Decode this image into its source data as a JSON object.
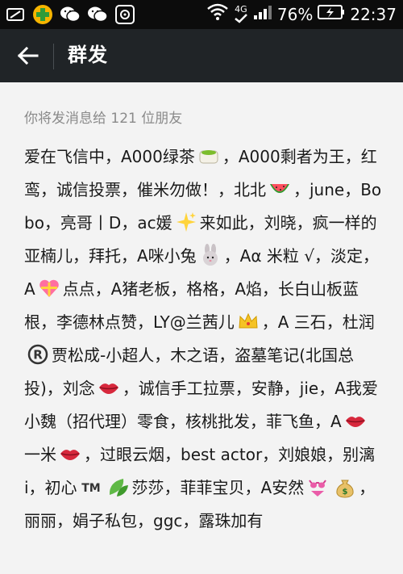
{
  "status_bar": {
    "left_icons": [
      "screen-icon",
      "game-icon",
      "wechat-icon",
      "wechat-icon",
      "shield-icon"
    ],
    "network": "4G",
    "battery": "76%",
    "time": "22:37"
  },
  "header": {
    "title": "群发"
  },
  "recipients": {
    "info": "你将发消息给 121 位朋友",
    "segments": [
      {
        "t": "爱在飞信中，A000绿茶"
      },
      {
        "e": "tea-icon"
      },
      {
        "t": "，A000剩者为王，红鸾，诚信投票，催米勿做！，北北"
      },
      {
        "e": "watermelon-icon"
      },
      {
        "t": "，june，Bobo，亮哥丨D，ac媛"
      },
      {
        "e": "sparkles-icon"
      },
      {
        "t": "来如此，刘晓，疯一样的亚楠儿，拜托，A咪小兔"
      },
      {
        "e": "rabbit-icon"
      },
      {
        "t": "，Aα 米粒 √，淡定，A"
      },
      {
        "e": "heart-gift-icon"
      },
      {
        "t": "点点，A猪老板，格格，A焰，长白山板蓝根，李德林点赞，LY@兰茜儿"
      },
      {
        "e": "crown-icon"
      },
      {
        "t": "，A 三石，杜润"
      },
      {
        "e": "registered-icon"
      },
      {
        "t": "贾松成-小超人，木之语，盗墓笔记(北国总投)，刘念"
      },
      {
        "e": "lips-icon"
      },
      {
        "t": "，诚信手工拉票，安静，jie，A我爱小魏（招代理）零食，核桃批发，菲飞鱼，A"
      },
      {
        "e": "lips-icon"
      },
      {
        "t": "一米"
      },
      {
        "e": "lips-icon"
      },
      {
        "t": "，过眼云烟，best actor，刘娘娘，别漓i，初心"
      },
      {
        "e": "trademark-icon"
      },
      {
        "e": "leaves-icon"
      },
      {
        "t": "莎莎，菲菲宝贝，A安然"
      },
      {
        "e": "bikini-icon"
      },
      {
        "e": "money-bag-icon"
      },
      {
        "t": "，丽丽，娟子私包，ggc，露珠加有"
      }
    ]
  }
}
